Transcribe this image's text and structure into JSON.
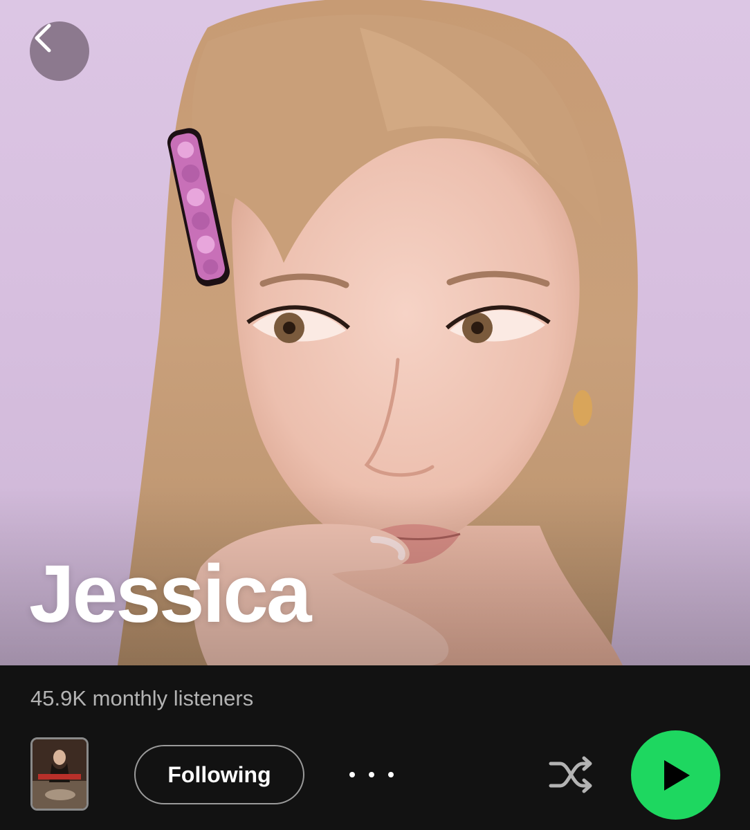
{
  "artist": {
    "name": "Jessica",
    "monthly_listeners": "45.9K monthly listeners"
  },
  "actions": {
    "follow_label": "Following",
    "more_label": "More options",
    "shuffle_label": "Shuffle",
    "play_label": "Play"
  },
  "icons": {
    "back": "chevron-left-icon",
    "more": "ellipsis-icon",
    "shuffle": "shuffle-icon",
    "play": "play-icon"
  },
  "colors": {
    "accent": "#1ed760",
    "background": "#121212",
    "secondary_text": "#b3b3b3"
  }
}
